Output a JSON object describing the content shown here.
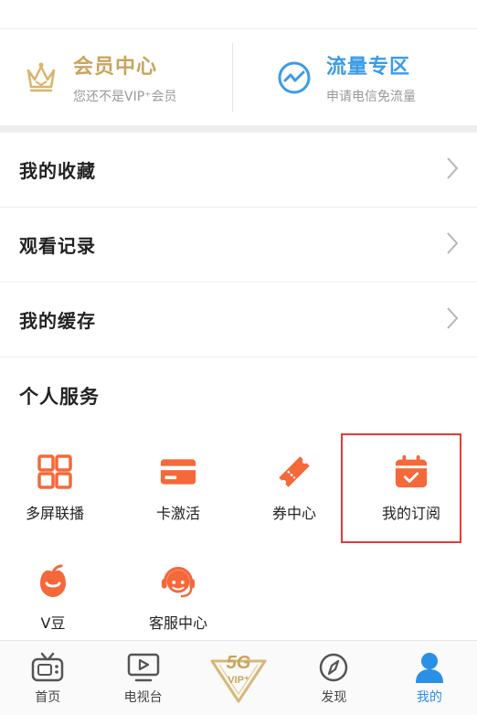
{
  "promo": {
    "vip": {
      "title": "会员中心",
      "subtitle": "您还不是VIP⁺会员"
    },
    "traffic": {
      "title": "流量专区",
      "subtitle": "申请电信免流量"
    }
  },
  "menu": [
    {
      "label": "我的收藏"
    },
    {
      "label": "观看记录"
    },
    {
      "label": "我的缓存"
    }
  ],
  "services": {
    "title": "个人服务",
    "items": [
      {
        "label": "多屏联播",
        "icon": "multi-screen-icon"
      },
      {
        "label": "卡激活",
        "icon": "card-icon"
      },
      {
        "label": "券中心",
        "icon": "ticket-icon"
      },
      {
        "label": "我的订阅",
        "icon": "calendar-check-icon"
      },
      {
        "label": "V豆",
        "icon": "bean-icon"
      },
      {
        "label": "客服中心",
        "icon": "headset-icon"
      }
    ]
  },
  "tabbar": {
    "home": "首页",
    "tv": "电视台",
    "center_badge": "5G VIP⁺",
    "discover": "发现",
    "mine": "我的"
  },
  "colors": {
    "accent_orange": "#f5683a",
    "accent_blue": "#2a8fe6",
    "gold": "#c9a45c",
    "highlight": "#e03a3a"
  }
}
